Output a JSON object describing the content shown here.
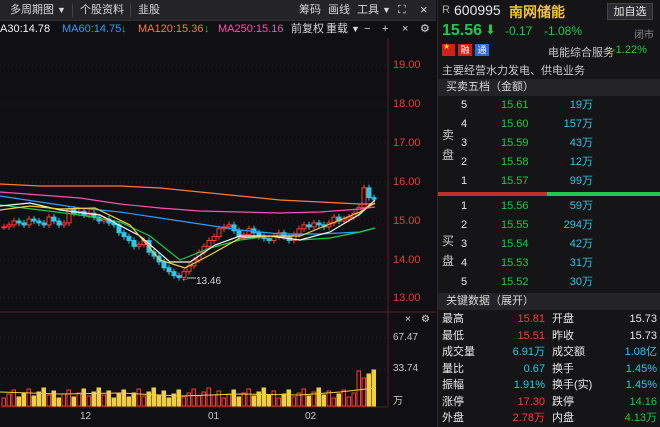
{
  "toolbar": {
    "period": "多周期图",
    "profile": "个股资料",
    "stock_link": "韭股",
    "zoom_in": "筹码",
    "draw": "画线",
    "tools": "工具"
  },
  "ma": {
    "ma30": "A30:14.78",
    "ma60": "MA60:14.75",
    "ma120": "MA120:15.36",
    "ma250": "MA250:15.16",
    "adjust": "前复权",
    "overlay": "重载"
  },
  "price_axis": [
    "19.00",
    "18.00",
    "17.00",
    "16.00",
    "15.00",
    "14.00",
    "13.00"
  ],
  "vol_axis": [
    "67.47",
    "33.74",
    "万"
  ],
  "date_axis": [
    "12",
    "01",
    "02"
  ],
  "low_label": "13.46",
  "stock": {
    "prefix": "R",
    "code": "600995",
    "name": "南网储能",
    "add": "加自选",
    "price": "15.56",
    "change": "-0.17",
    "pct": "-1.08%",
    "status": "闭市",
    "tag1": "融",
    "tag2": "通",
    "sector": "电能综合服务",
    "sector_pct": "-1.22%",
    "business": "主要经营水力发电、供电业务"
  },
  "orderbook": {
    "title": "买卖五档（金额）",
    "sell_label": [
      "卖",
      "盘"
    ],
    "buy_label": [
      "买",
      "盘"
    ],
    "sells": [
      {
        "lvl": "5",
        "price": "15.61",
        "amt": "19万"
      },
      {
        "lvl": "4",
        "price": "15.60",
        "amt": "157万"
      },
      {
        "lvl": "3",
        "price": "15.59",
        "amt": "43万"
      },
      {
        "lvl": "2",
        "price": "15.58",
        "amt": "12万"
      },
      {
        "lvl": "1",
        "price": "15.57",
        "amt": "99万"
      }
    ],
    "buys": [
      {
        "lvl": "1",
        "price": "15.56",
        "amt": "59万"
      },
      {
        "lvl": "2",
        "price": "15.55",
        "amt": "294万"
      },
      {
        "lvl": "3",
        "price": "15.54",
        "amt": "42万"
      },
      {
        "lvl": "4",
        "price": "15.53",
        "amt": "31万"
      },
      {
        "lvl": "5",
        "price": "15.52",
        "amt": "30万"
      }
    ],
    "buy_ratio": 0.51
  },
  "keydata": {
    "title": "关键数据（展开）",
    "rows": [
      {
        "l1": "最高",
        "v1": "15.81",
        "c1": "red",
        "l2": "开盘",
        "v2": "15.73",
        "c2": "white"
      },
      {
        "l1": "最低",
        "v1": "15.51",
        "c1": "red",
        "l2": "昨收",
        "v2": "15.73",
        "c2": "white"
      },
      {
        "l1": "成交量",
        "v1": "6.91万",
        "c1": "cyan",
        "l2": "成交额",
        "v2": "1.08亿",
        "c2": "cyan"
      },
      {
        "l1": "量比",
        "v1": "0.67",
        "c1": "cyan",
        "l2": "换手",
        "v2": "1.45%",
        "c2": "cyan"
      },
      {
        "l1": "振幅",
        "v1": "1.91%",
        "c1": "cyan",
        "l2": "换手(实)",
        "v2": "1.45%",
        "c2": "cyan"
      },
      {
        "l1": "涨停",
        "v1": "17.30",
        "c1": "red",
        "l2": "跌停",
        "v2": "14.16",
        "c2": "green"
      },
      {
        "l1": "外盘",
        "v1": "2.78万",
        "c1": "red",
        "l2": "内盘",
        "v2": "4.13万",
        "c2": "green"
      }
    ]
  }
}
